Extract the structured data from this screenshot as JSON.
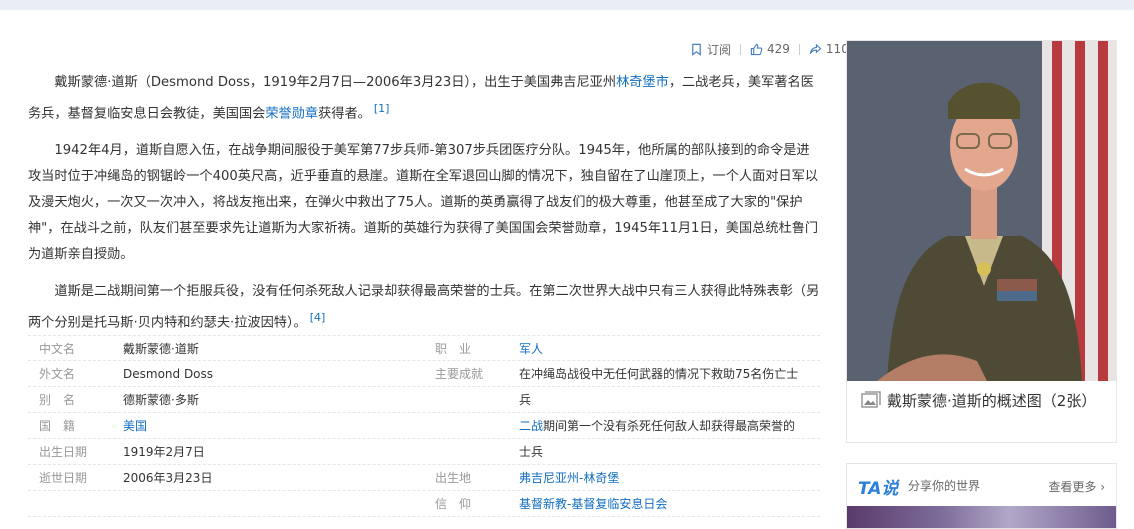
{
  "actions": {
    "subscribe": "订阅",
    "likes": "429",
    "shares": "110"
  },
  "intro": {
    "p1_a": "戴斯蒙德·道斯（Desmond Doss，1919年2月7日—2006年3月23日），出生于美国弗吉尼亚州",
    "p1_link1": "林奇堡市",
    "p1_b": "，二战老兵，美军著名医务兵，基督复临安息日会教徒，美国国会",
    "p1_link2": "荣誉勋章",
    "p1_c": "获得者。",
    "p1_ref": "[1]",
    "p2": "1942年4月，道斯自愿入伍，在战争期间服役于美军第77步兵师-第307步兵团医疗分队。1945年，他所属的部队接到的命令是进攻当时位于冲绳岛的钢锯岭一个400英尺高，近乎垂直的悬崖。道斯在全军退回山脚的情况下，独自留在了山崖顶上，一个人面对日军以及漫天炮火，一次又一次冲入，将战友拖出来，在弹火中救出了75人。道斯的英勇赢得了战友们的极大尊重，他甚至成了大家的\"保护神\"，在战斗之前，队友们甚至要求先让道斯为大家祈祷。道斯的英雄行为获得了美国国会荣誉勋章，1945年11月1日，美国总统杜鲁门为道斯亲自授勋。",
    "p3": "道斯是二战期间第一个拒服兵役，没有任何杀死敌人记录却获得最高荣誉的士兵。在第二次世界大战中只有三人获得此特殊表彰（另两个分别是托马斯·贝内特和约瑟夫·拉波因特）。",
    "p3_ref": "[4]"
  },
  "info": {
    "rows": [
      {
        "lk": "中文名",
        "lv": "戴斯蒙德·道斯",
        "rk": "职　业",
        "rv": "军人"
      },
      {
        "lk": "外文名",
        "lv": "Desmond Doss",
        "rk": "主要成就",
        "rv": "在冲绳岛战役中无任何武器的情况下救助75名伤亡士"
      },
      {
        "lk": "别　名",
        "lv": "德斯蒙德·多斯",
        "rk": "",
        "rv": "兵"
      },
      {
        "lk": "国　籍",
        "lv": "美国",
        "rk": "",
        "rv": "二战期间第一个没有杀死任何敌人却获得最高荣誉的"
      },
      {
        "lk": "出生日期",
        "lv": "1919年2月7日",
        "rk": "",
        "rv": "士兵"
      },
      {
        "lk": "逝世日期",
        "lv": "2006年3月23日",
        "rk": "出生地",
        "rv": "弗吉尼亚州-林奇堡"
      },
      {
        "lk": "",
        "lv": "",
        "rk": "信　仰",
        "rv": "基督新教-基督复临安息日会"
      }
    ]
  },
  "sidebar": {
    "caption": "戴斯蒙德·道斯的概述图（2张）",
    "ta_logo": "TA说",
    "ta_slogan": "分享你的世界",
    "ta_more": "查看更多"
  },
  "colors": {
    "link": "#136ec2",
    "label": "#999999",
    "text": "#333333"
  }
}
